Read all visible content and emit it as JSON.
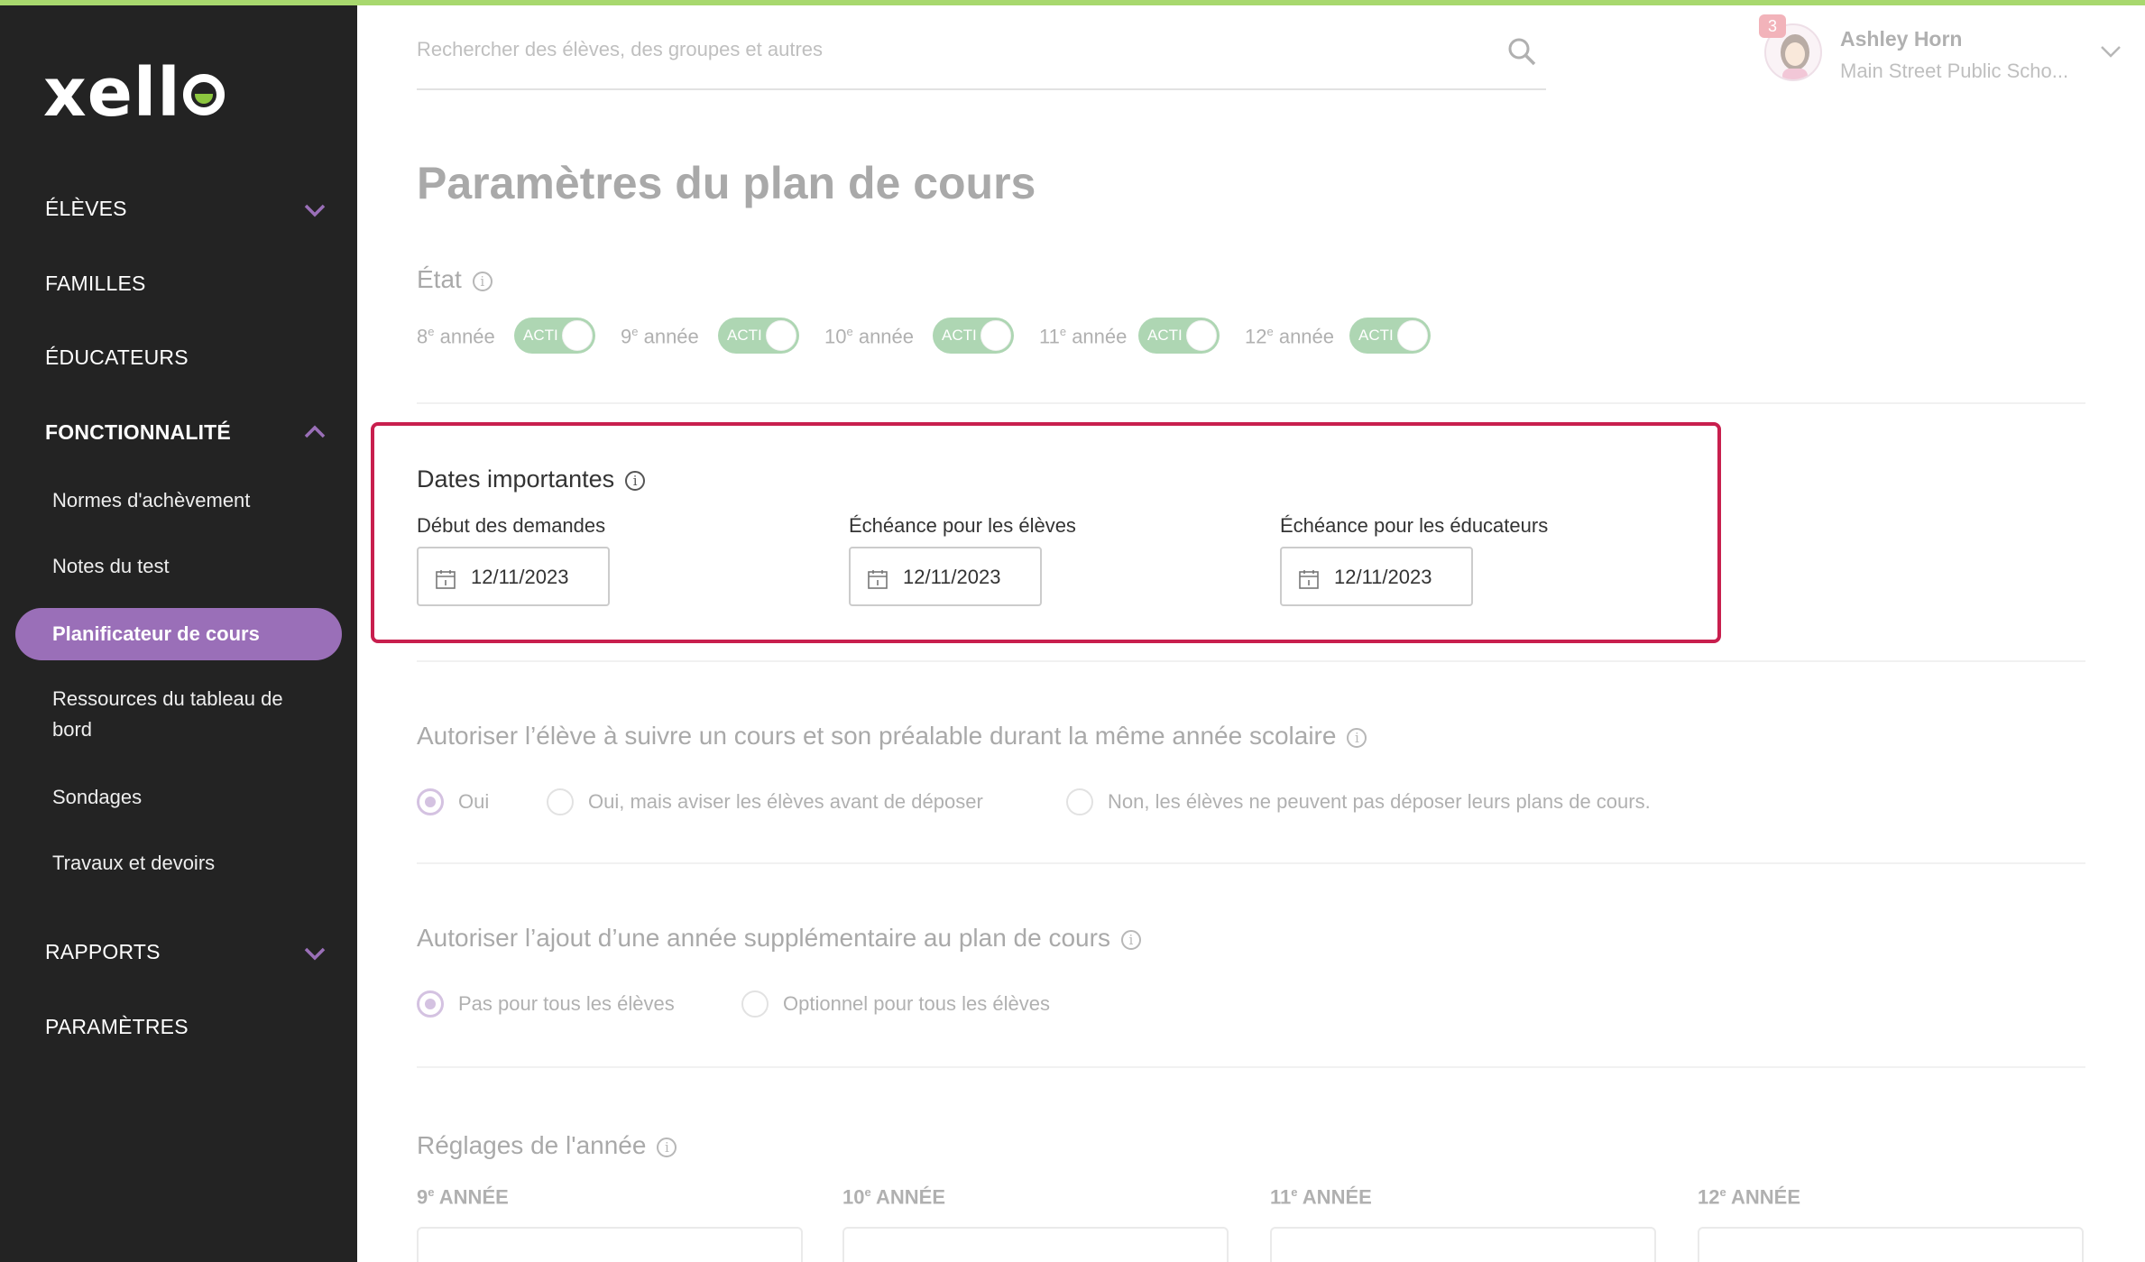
{
  "sidebar": {
    "logo": "xello",
    "nav": [
      {
        "label": "ÉLÈVES",
        "chevron": "down"
      },
      {
        "label": "FAMILLES"
      },
      {
        "label": "ÉDUCATEURS"
      },
      {
        "label": "FONCTIONNALITÉ",
        "chevron": "up",
        "expanded": true
      },
      {
        "label": "RAPPORTS",
        "chevron": "down"
      },
      {
        "label": "PARAMÈTRES"
      }
    ],
    "sub_items": [
      "Normes d'achèvement",
      "Notes du test",
      "Planificateur de cours",
      "Ressources du tableau de bord",
      "Sondages",
      "Travaux et devoirs"
    ],
    "active_sub_item": "Planificateur de cours"
  },
  "header": {
    "search_placeholder": "Rechercher des élèves, des groupes et autres",
    "user_name": "Ashley Horn",
    "user_school": "Main Street Public Scho...",
    "notification_count": "3"
  },
  "page": {
    "title": "Paramètres du plan de cours",
    "etat": {
      "title": "État",
      "grades": [
        {
          "num": "8",
          "sup": "e",
          "label": " année",
          "toggle": "ACTI"
        },
        {
          "num": "9",
          "sup": "e",
          "label": " année",
          "toggle": "ACTI"
        },
        {
          "num": "10",
          "sup": "e",
          "label": " année",
          "toggle": "ACTI"
        },
        {
          "num": "11",
          "sup": "e",
          "label": " année",
          "toggle": "ACTI"
        },
        {
          "num": "12",
          "sup": "e",
          "label": " année",
          "toggle": "ACTI"
        }
      ]
    },
    "dates": {
      "title": "Dates importantes",
      "fields": [
        {
          "label": "Début des demandes",
          "value": "12/11/2023"
        },
        {
          "label": "Échéance pour les élèves",
          "value": "12/11/2023"
        },
        {
          "label": "Échéance pour les éducateurs",
          "value": "12/11/2023"
        }
      ]
    },
    "prereq": {
      "title": "Autoriser l’élève à suivre un cours et son préalable durant la même année scolaire",
      "options": [
        "Oui",
        "Oui, mais aviser les élèves avant de déposer",
        "Non, les élèves ne peuvent pas déposer leurs plans de cours."
      ],
      "selected": 0
    },
    "extra_year": {
      "title": "Autoriser l’ajout d’une année supplémentaire au plan de cours",
      "options": [
        "Pas pour tous les élèves",
        "Optionnel pour tous les élèves"
      ],
      "selected": 0
    },
    "year_settings": {
      "title": "Réglages de l'année",
      "years": [
        {
          "num": "9",
          "sup": "e",
          "label": " ANNÉE"
        },
        {
          "num": "10",
          "sup": "e",
          "label": " ANNÉE"
        },
        {
          "num": "11",
          "sup": "e",
          "label": " ANNÉE"
        },
        {
          "num": "12",
          "sup": "e",
          "label": " ANNÉE"
        }
      ]
    }
  },
  "colors": {
    "sidebar_bg": "#232323",
    "accent_purple": "#9a6fb8",
    "toggle_green": "#3e9e4a",
    "focus_border": "#c81f4e",
    "top_bar": "#a8d86e"
  }
}
